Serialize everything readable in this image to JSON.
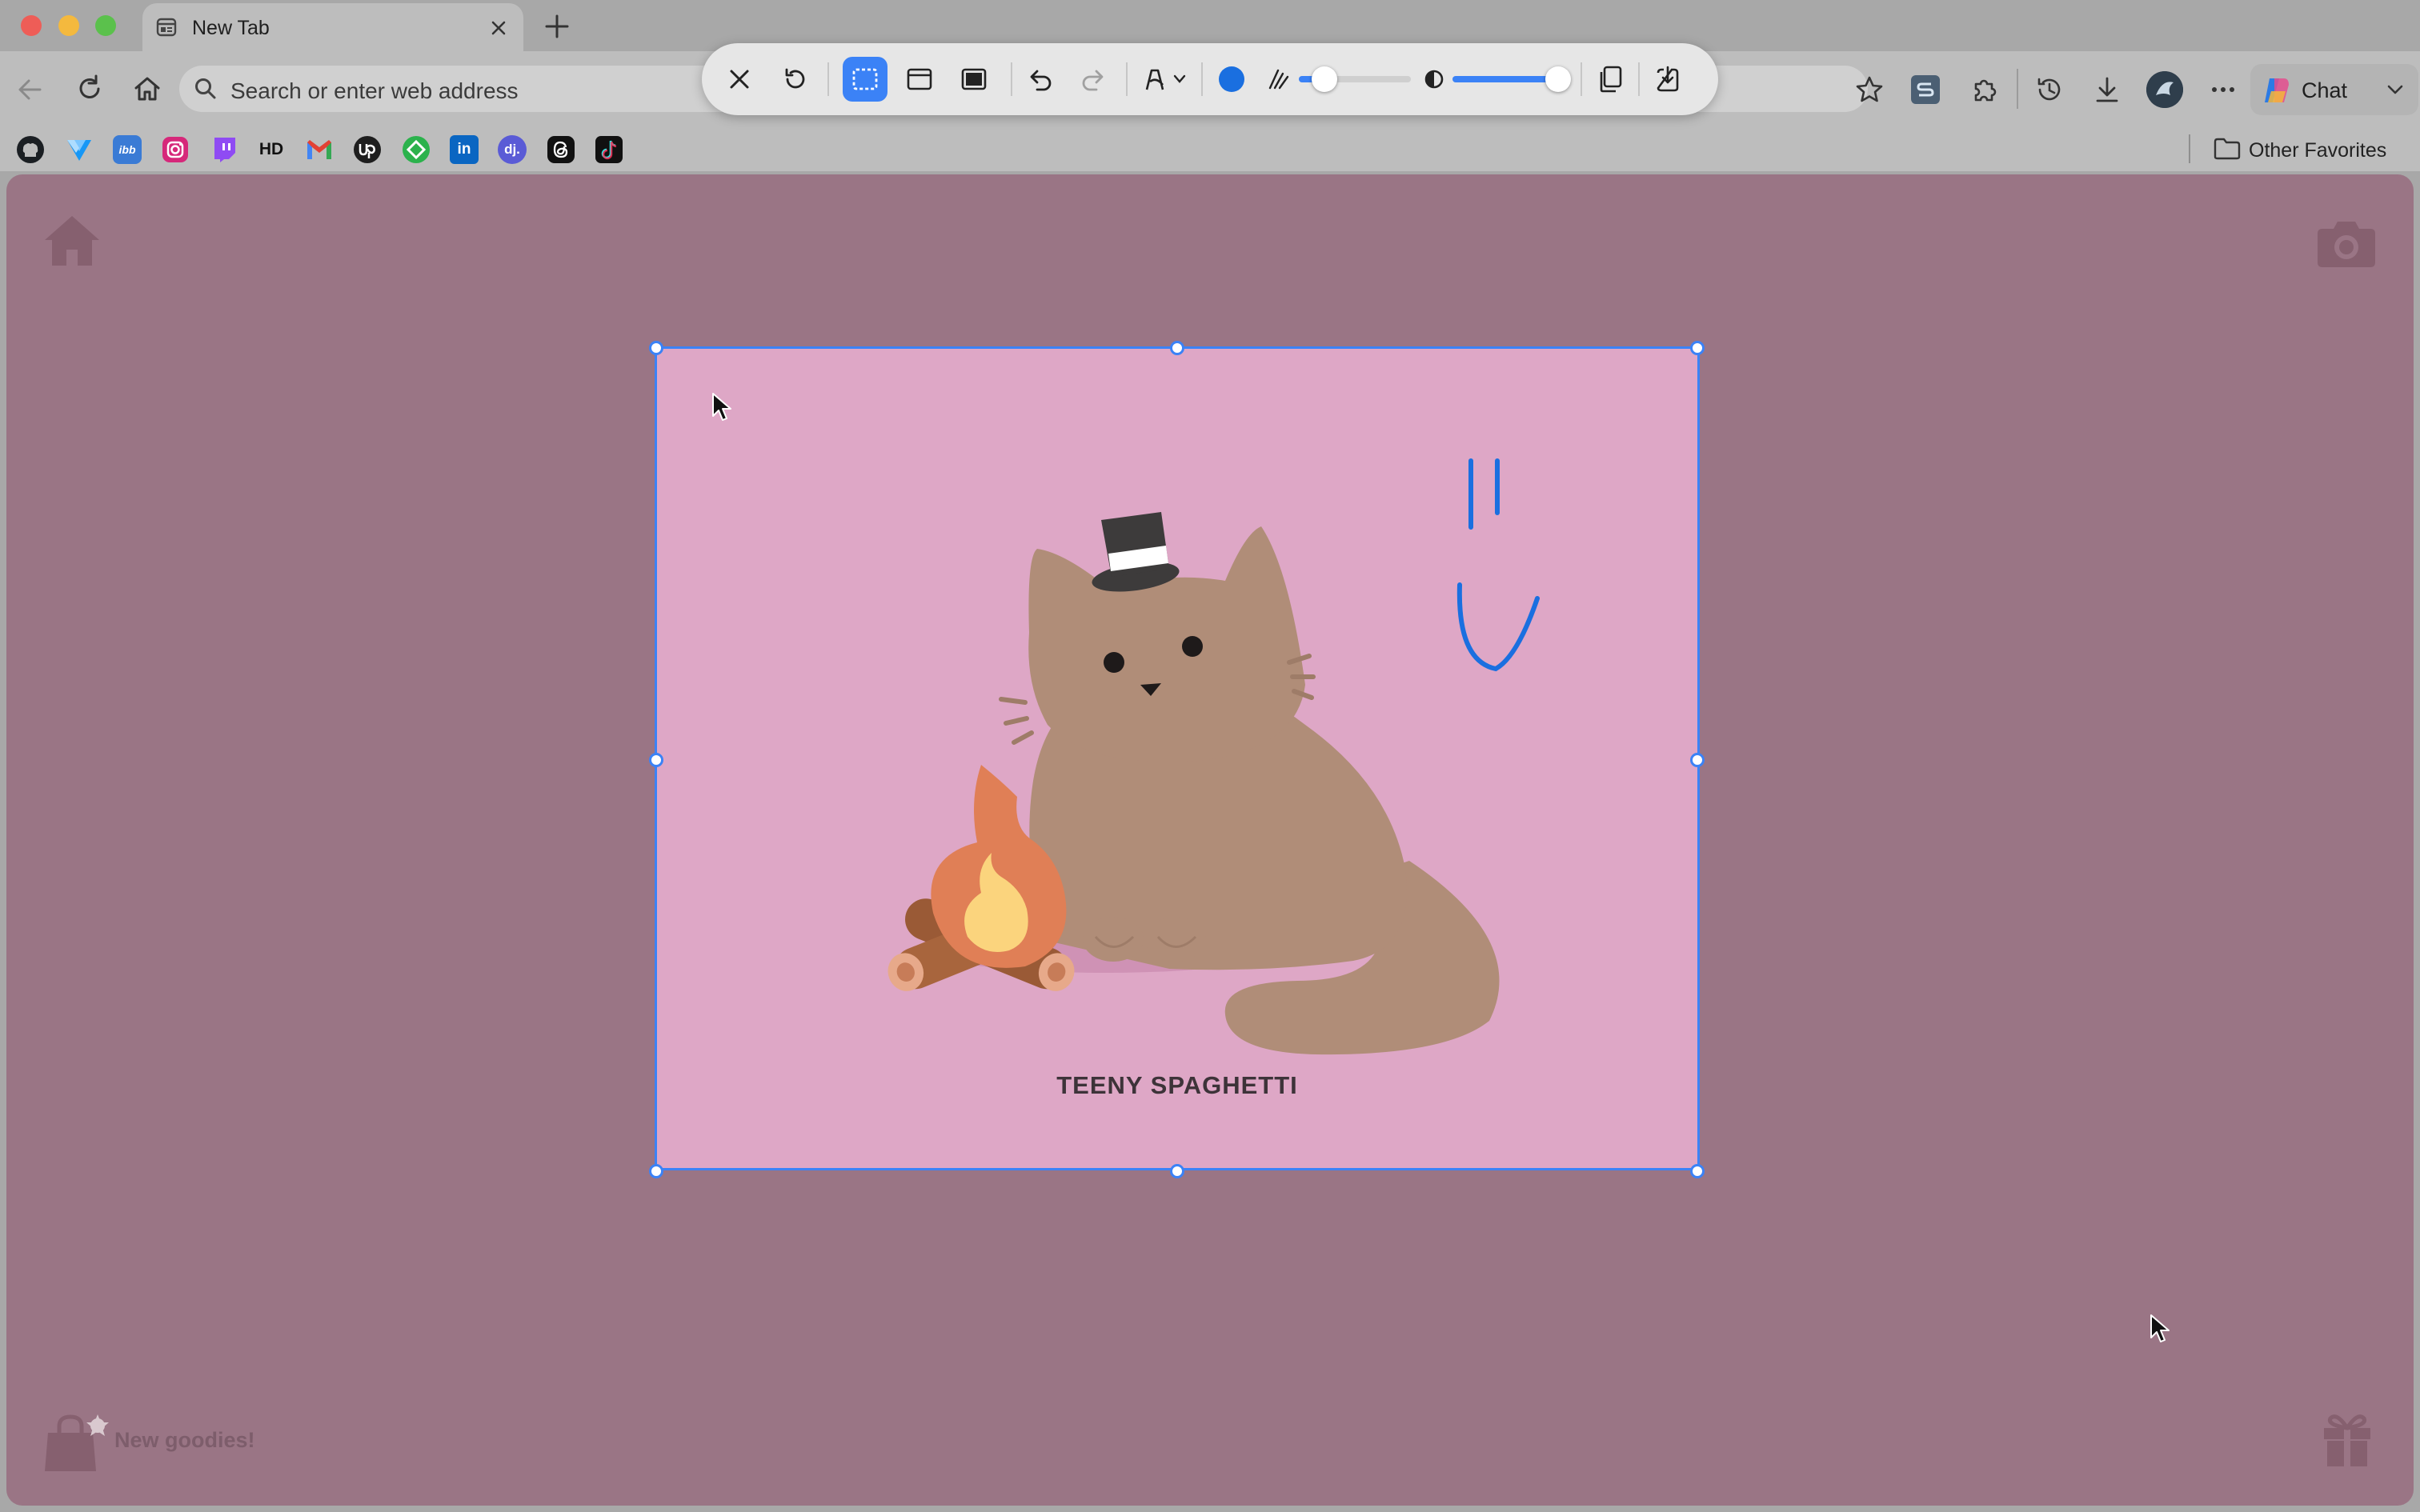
{
  "window": {
    "tab_title": "New Tab",
    "address_placeholder": "Search or enter web address"
  },
  "bookmarks": {
    "items": [
      "github",
      "vuetify",
      "ibb",
      "instagram",
      "twitch",
      "HD",
      "gmail",
      "upwork",
      "feedly",
      "in",
      "dj.",
      "threads",
      "tiktok"
    ],
    "hd_label": "HD",
    "ibb_label": "ibb",
    "linkedin_label": "in",
    "dj_label": "dj.",
    "other_favorites": "Other Favorites"
  },
  "toolbar": {
    "chat_label": "Chat"
  },
  "capture": {
    "pen_color": "#1a6fe0",
    "stroke_size": 0.2,
    "opacity": 1.0
  },
  "page": {
    "art_caption": "TEENY SPAGHETTI",
    "goodies_label": "New goodies!"
  },
  "colors": {
    "accent": "#3b82f6",
    "background": "#9a7585",
    "art_background": "#dea7c6"
  }
}
